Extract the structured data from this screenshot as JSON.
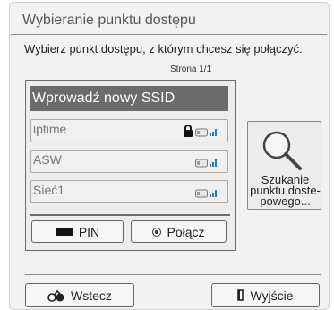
{
  "dialog": {
    "title": "Wybieranie punktu dostępu",
    "instruction": "Wybierz punkt dostępu, z którym chcesz się połączyć.",
    "page_info": "Strona 1/1"
  },
  "network_list": {
    "new_ssid_label": "Wprowadź nowy SSID",
    "networks": [
      {
        "name": "iptime",
        "secured": true,
        "signal_icon": "wifi-signal-icon"
      },
      {
        "name": "ASW",
        "secured": false,
        "signal_icon": "wifi-signal-icon"
      },
      {
        "name": "Sieć1",
        "secured": false,
        "signal_icon": "wifi-signal-icon"
      }
    ],
    "pin_label": "PIN",
    "connect_label": "Połącz"
  },
  "search": {
    "label": "Szukanie\npunktu doste-\npowego..."
  },
  "footer": {
    "back_label": "Wstecz",
    "exit_label": "Wyjście"
  },
  "colors": {
    "selected_bg": "#6b6b6b",
    "signal_accent": "#1a7fd4"
  }
}
